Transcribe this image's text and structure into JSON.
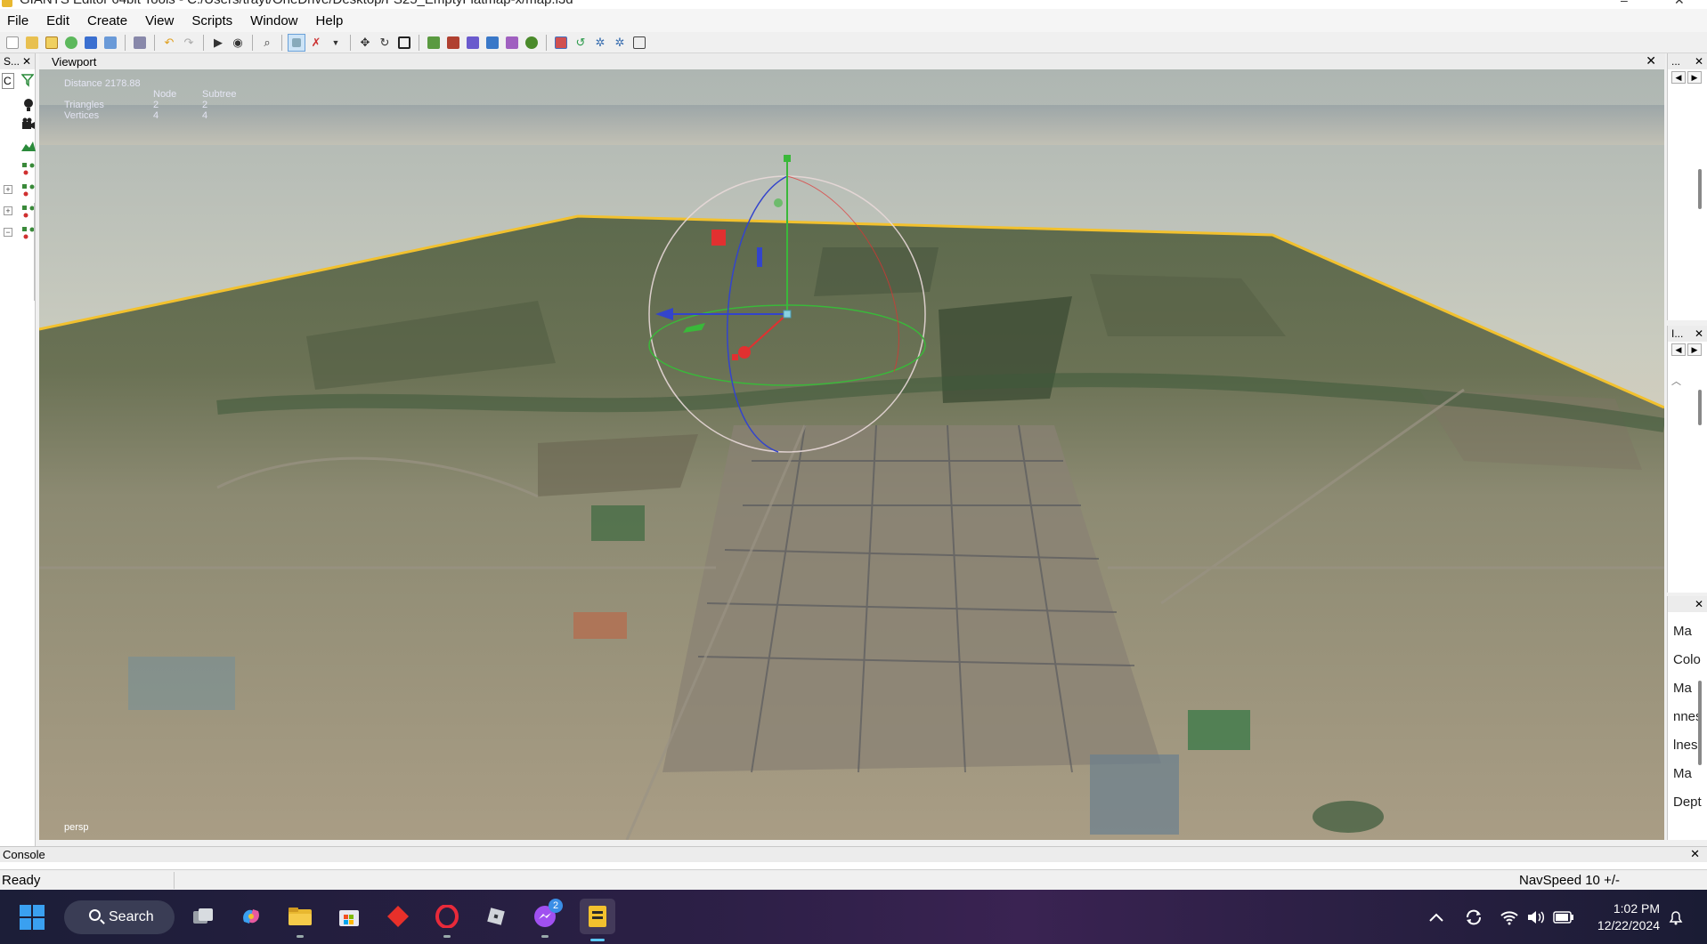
{
  "window": {
    "title": "GIANTS Editor 64bit Tools - C:/Users/trayt/OneDrive/Desktop/FS25_EmptyFlatmap-x/map.i3d",
    "minimize_glyph": "–",
    "close_glyph": "✕"
  },
  "menu": {
    "items": [
      "File",
      "Edit",
      "Create",
      "View",
      "Scripts",
      "Window",
      "Help"
    ]
  },
  "toolbar": {
    "icons": [
      "new-file-icon",
      "open-folder-icon",
      "edit-icon",
      "refresh-icon",
      "save-icon",
      "export-icon",
      "find-icon",
      "undo-icon",
      "redo-icon",
      "play-icon",
      "eye-icon",
      "zoom-icon",
      "select-icon",
      "terrain-paint-icon",
      "dropdown-icon",
      "move-icon",
      "rotate-icon",
      "scale-icon",
      "terrain-sculpt-icon",
      "foliage-paint-icon",
      "paint-brush-icon",
      "spline-icon",
      "scatter-icon",
      "tree-icon",
      "layers-icon",
      "reload-icon",
      "settings-icon",
      "gear2-icon",
      "clipboard-icon"
    ]
  },
  "left_panel": {
    "title": "S...",
    "close": "✕",
    "filter_text": "C"
  },
  "viewport": {
    "title": "Viewport",
    "close": "✕",
    "stats": {
      "distance_label": "Distance",
      "distance_value": "2178.88",
      "node_header": "Node",
      "subtree_header": "Subtree",
      "triangles_label": "Triangles",
      "triangles_node": "2",
      "triangles_subtree": "2",
      "vertices_label": "Vertices",
      "vertices_node": "4",
      "vertices_subtree": "4"
    },
    "camera": "persp"
  },
  "right_panels": [
    {
      "title": "...",
      "close": "✕"
    },
    {
      "title": "I...",
      "close": "✕"
    },
    {
      "title": "",
      "close": "✕",
      "rows": [
        "Ma",
        "Colo",
        "Ma",
        "nnes",
        "lnes",
        "Ma",
        "Dept"
      ]
    }
  ],
  "console": {
    "title": "Console",
    "close": "✕"
  },
  "status": {
    "left": "Ready",
    "right": "NavSpeed 10 +/-"
  },
  "taskbar": {
    "search_label": "Search",
    "messenger_badge": "2",
    "time": "1:02 PM",
    "date": "12/22/2024"
  },
  "colors": {
    "terrain_outline": "#f2c12e",
    "gizmo_x": "#e23030",
    "gizmo_y": "#3ab83a",
    "gizmo_z": "#3344cc",
    "taskbar_accent": "#5cc8f5"
  }
}
